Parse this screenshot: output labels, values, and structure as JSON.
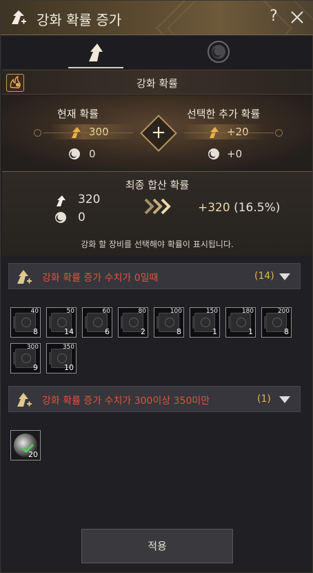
{
  "window": {
    "title": "강화 확률 증가",
    "help_label": "?",
    "icons": [
      "enhance-arrow-icon",
      "help-icon",
      "close-icon"
    ]
  },
  "tabs": [
    {
      "icon": "enhance-arrow-icon",
      "selected": true
    },
    {
      "icon": "moon-icon",
      "selected": false
    }
  ],
  "section": {
    "title": "강화 확률"
  },
  "probability": {
    "current_label": "현재 확률",
    "current_enhance": "300",
    "current_moon": "0",
    "added_label": "선택한 추가 확률",
    "added_enhance": "+20",
    "added_moon": "+0"
  },
  "final": {
    "title": "최종 합산 확률",
    "enhance": "320",
    "moon": "0",
    "result_value": "+320",
    "result_pct": "(16.5%)",
    "hint": "강화 할 장비를 선택해야 확률이 표시됩니다."
  },
  "groups": [
    {
      "label": "강화 확률 증가 수치가 0일때",
      "count": "(14)",
      "items": [
        {
          "top": "40",
          "count": "8"
        },
        {
          "top": "50",
          "count": "14"
        },
        {
          "top": "60",
          "count": "6"
        },
        {
          "top": "80",
          "count": "2"
        },
        {
          "top": "100",
          "count": "8"
        },
        {
          "top": "150",
          "count": "1"
        },
        {
          "top": "180",
          "count": "1"
        },
        {
          "top": "200",
          "count": "8"
        },
        {
          "top": "300",
          "count": "9"
        },
        {
          "top": "350",
          "count": "10"
        }
      ]
    },
    {
      "label": "강화 확률 증가 수치가 300이상 350미만",
      "count": "(1)",
      "items": [
        {
          "count": "20",
          "selected": true
        }
      ]
    }
  ],
  "apply_label": "적용",
  "colors": {
    "accent_gold": "#f0d9a6",
    "group_label_red": "#e0533f",
    "group_count_gold": "#e0b452"
  }
}
